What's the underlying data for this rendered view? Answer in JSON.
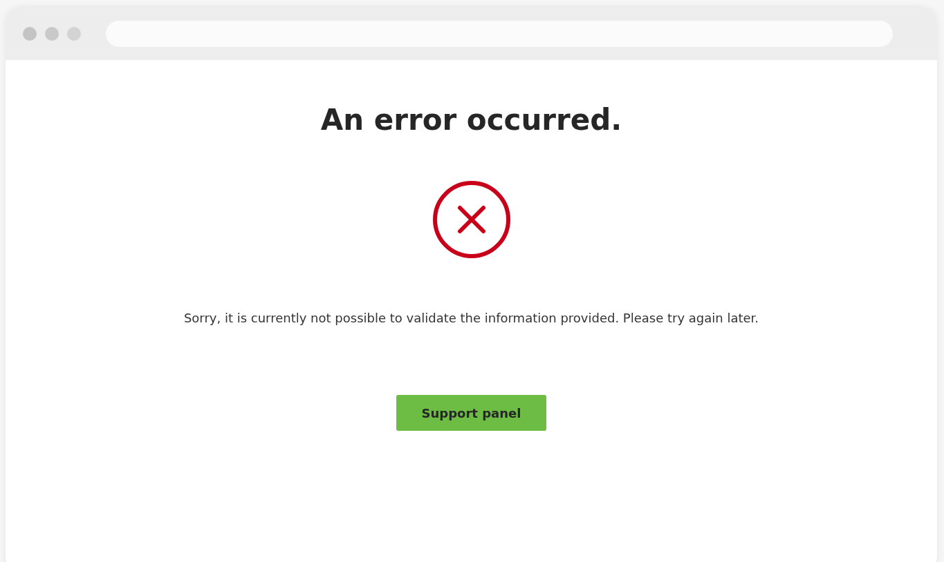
{
  "page": {
    "heading": "An error occurred.",
    "message": "Sorry, it is currently not possible to validate the information provided. Please try again later.",
    "button": "Support panel"
  }
}
